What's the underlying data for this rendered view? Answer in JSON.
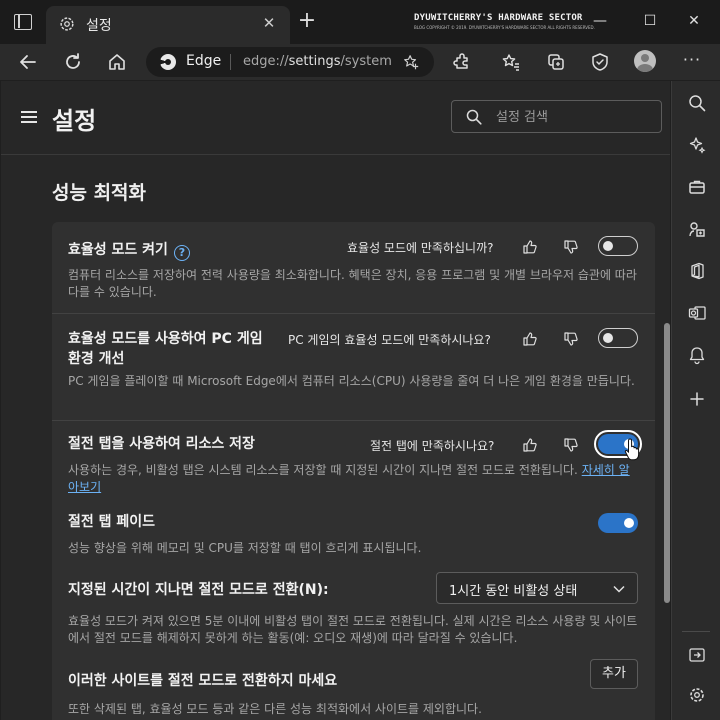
{
  "tab": {
    "title": "설정",
    "close_glyph": "✕",
    "new_tab_glyph": "+"
  },
  "watermark": {
    "line1": "DYUWITCHERRY'S HARDWARE SECTOR",
    "line2": "BLOG COPYRIGHT © 2019. DYUWITCHERRY'S HARDWARE SECTOR ALL RIGHTS RESERVED."
  },
  "window_controls": {
    "minimize": "—",
    "maximize": "☐",
    "close": "✕"
  },
  "address_bar": {
    "site_name": "Edge",
    "url_prefix": "edge://",
    "url_bold": "settings",
    "url_suffix": "/system"
  },
  "header": {
    "title": "설정",
    "search_placeholder": "설정 검색"
  },
  "section": {
    "title": "성능 최적화"
  },
  "rows": [
    {
      "title": "효율성 모드 켜기",
      "has_help": true,
      "help_glyph": "?",
      "feedback": "효율성 모드에 만족하십니까?",
      "toggle": "off",
      "description": "컴퓨터 리소스를 저장하여 전력 사용량을 최소화합니다. 혜택은 장치, 응용 프로그램 및 개별 브라우저 습관에 따라 다를 수 있습니다."
    },
    {
      "title_line1": "효율성 모드를 사용하여 PC 게임",
      "title_line2": "환경 개선",
      "feedback": "PC 게임의 효율성 모드에 만족하시나요?",
      "toggle": "off",
      "description": "PC 게임을 플레이할 때 Microsoft Edge에서 컴퓨터 리소스(CPU) 사용량을 줄여 더 나은 게임 환경을 만듭니다."
    },
    {
      "title": "절전 탭을 사용하여 리소스 저장",
      "feedback": "절전 탭에 만족하시나요?",
      "toggle": "on",
      "description": "사용하는 경우, 비활성 탭은 시스템 리소스를 저장할 때 지정된 시간이 지나면 절전 모드로 전환됩니다.",
      "link": "자세히 알아보기"
    },
    {
      "title": "절전 탭 페이드",
      "toggle": "on",
      "description": "성능 향상을 위해 메모리 및 CPU를 저장할 때 탭이 흐리게 표시됩니다."
    },
    {
      "title": "지정된 시간이 지나면 절전 모드로 전환(N):",
      "select_value": "1시간 동안 비활성 상태",
      "description": "효율성 모드가 켜져 있으면 5분 이내에 비활성 탭이 절전 모드로 전환됩니다. 실제 시간은 리소스 사용량 및 사이트에서 절전 모드를 해제하지 못하게 하는 활동(예: 오디오 재생)에 따라 달라질 수 있습니다."
    },
    {
      "title": "이러한 사이트를 절전 모드로 전환하지 마세요",
      "button": "추가",
      "description": "또한 삭제된 탭, 효율성 모드 등과 같은 다른 성능 최적화에서 사이트를 제외합니다."
    }
  ]
}
